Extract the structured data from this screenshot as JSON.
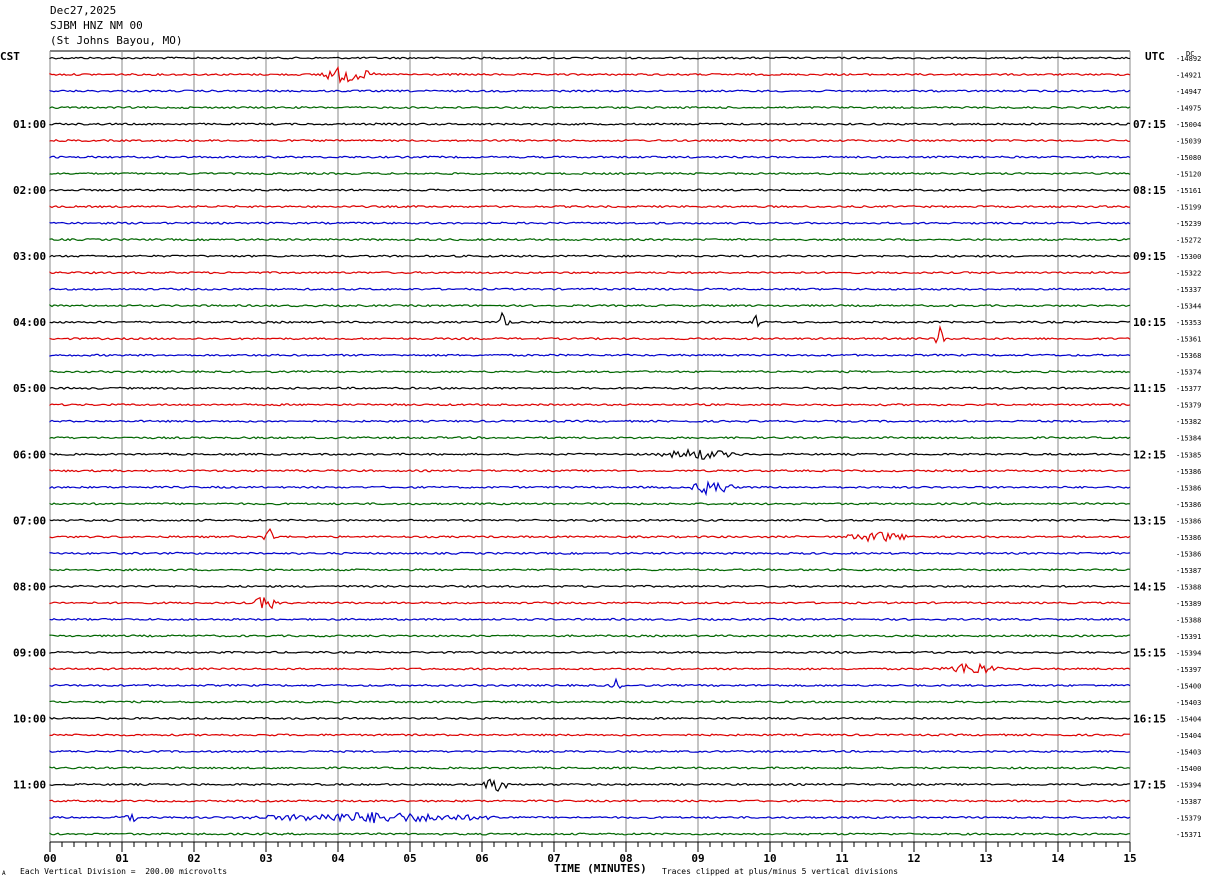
{
  "header": {
    "date": "Dec27,2025",
    "station": "SJBM HNZ NM 00",
    "location": "(St Johns Bayou, MO)"
  },
  "left_tz": "CST",
  "right_tz": "UTC",
  "dc_label": "DC",
  "footer": {
    "scale_note": "Each Vertical Division =  200.00 microvolts",
    "xlabel": "TIME (MINUTES)",
    "clip_note": "Traces clipped at plus/minus 5 vertical divisions",
    "corner_mark": "A"
  },
  "colors": {
    "trace_cycle": [
      "#000000",
      "#dd0000",
      "#0000cc",
      "#006600"
    ],
    "grid": "#888888"
  },
  "chart_data": {
    "type": "line",
    "title": "SJBM HNZ NM 00",
    "xlabel": "TIME (MINUTES)",
    "xlim": [
      0,
      15
    ],
    "x_ticks": [
      "00",
      "01",
      "02",
      "03",
      "04",
      "05",
      "06",
      "07",
      "08",
      "09",
      "10",
      "11",
      "12",
      "13",
      "14",
      "15"
    ],
    "rows_per_hour": 4,
    "left_hour_labels": [
      "01:00",
      "02:00",
      "03:00",
      "04:00",
      "05:00",
      "06:00",
      "07:00",
      "08:00",
      "09:00",
      "10:00",
      "11:00"
    ],
    "right_hour_labels": [
      "07:15",
      "08:15",
      "09:15",
      "10:15",
      "11:15",
      "12:15",
      "13:15",
      "14:15",
      "15:15",
      "16:15",
      "17:15"
    ],
    "dc_offsets": [
      "-14892",
      "-14921",
      "-14947",
      "-14975",
      "-15004",
      "-15039",
      "-15080",
      "-15120",
      "-15161",
      "-15199",
      "-15239",
      "-15272",
      "-15300",
      "-15322",
      "-15337",
      "-15344",
      "-15353",
      "-15361",
      "-15368",
      "-15374",
      "-15377",
      "-15379",
      "-15382",
      "-15384",
      "-15385",
      "-15386",
      "-15386",
      "-15386",
      "-15386",
      "-15386",
      "-15386",
      "-15387",
      "-15388",
      "-15389",
      "-15388",
      "-15391",
      "-15394",
      "-15397",
      "-15400",
      "-15403",
      "-15404",
      "-15404",
      "-15403",
      "-15400",
      "-15394",
      "-15387",
      "-15379",
      "-15371"
    ],
    "events": [
      {
        "row": 1,
        "minute": 4.1,
        "amplitude": 0.5,
        "width_min": 0.8
      },
      {
        "row": 16,
        "minute": 6.3,
        "amplitude": 1.0,
        "width_min": 0.1
      },
      {
        "row": 16,
        "minute": 9.8,
        "amplitude": 0.4,
        "width_min": 0.08
      },
      {
        "row": 17,
        "minute": 12.35,
        "amplitude": 1.0,
        "width_min": 0.05
      },
      {
        "row": 24,
        "minute": 9.0,
        "amplitude": 0.3,
        "width_min": 1.2
      },
      {
        "row": 26,
        "minute": 9.2,
        "amplitude": 0.5,
        "width_min": 0.6
      },
      {
        "row": 29,
        "minute": 3.05,
        "amplitude": 0.6,
        "width_min": 0.1
      },
      {
        "row": 29,
        "minute": 11.5,
        "amplitude": 0.3,
        "width_min": 1.0
      },
      {
        "row": 33,
        "minute": 3.0,
        "amplitude": 0.5,
        "width_min": 0.3
      },
      {
        "row": 37,
        "minute": 12.8,
        "amplitude": 0.4,
        "width_min": 0.8
      },
      {
        "row": 38,
        "minute": 7.85,
        "amplitude": 0.5,
        "width_min": 0.08
      },
      {
        "row": 44,
        "minute": 6.2,
        "amplitude": 0.4,
        "width_min": 0.4
      },
      {
        "row": 46,
        "minute": 1.1,
        "amplitude": 0.3,
        "width_min": 0.3
      },
      {
        "row": 46,
        "minute": 4.5,
        "amplitude": 0.3,
        "width_min": 4.0
      }
    ]
  }
}
